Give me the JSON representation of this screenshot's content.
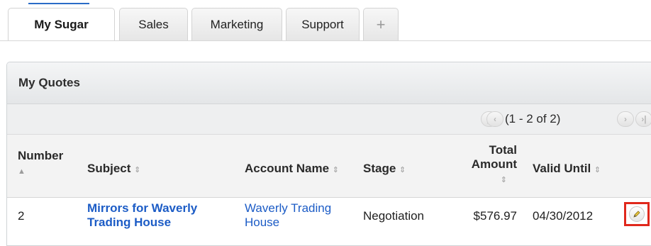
{
  "tabs": [
    {
      "label": "My Sugar",
      "active": true
    },
    {
      "label": "Sales",
      "active": false
    },
    {
      "label": "Marketing",
      "active": false
    },
    {
      "label": "Support",
      "active": false
    },
    {
      "label": "+",
      "active": false
    }
  ],
  "dashlet": {
    "title": "My Quotes",
    "pager": {
      "count_text": "(1 - 2 of 2)"
    },
    "columns": {
      "number": "Number",
      "subject": "Subject",
      "account_name": "Account Name",
      "stage": "Stage",
      "total_amount_line1": "Total",
      "total_amount_line2": "Amount",
      "valid_until": "Valid Until"
    },
    "rows": [
      {
        "number": "2",
        "subject_line1": "Mirrors for Waverly",
        "subject_line2": "Trading House",
        "account_line1": "Waverly Trading",
        "account_line2": "House",
        "stage": "Negotiation",
        "total_amount": "$576.97",
        "valid_until": "04/30/2012"
      }
    ]
  },
  "colors": {
    "link": "#1c5cc6",
    "highlight": "#e0281c"
  },
  "icons": {
    "sort": "sort-arrows-icon",
    "edit": "pencil-icon",
    "first": "first-page-icon",
    "prev": "previous-page-icon",
    "next": "next-page-icon",
    "last": "last-page-icon"
  }
}
